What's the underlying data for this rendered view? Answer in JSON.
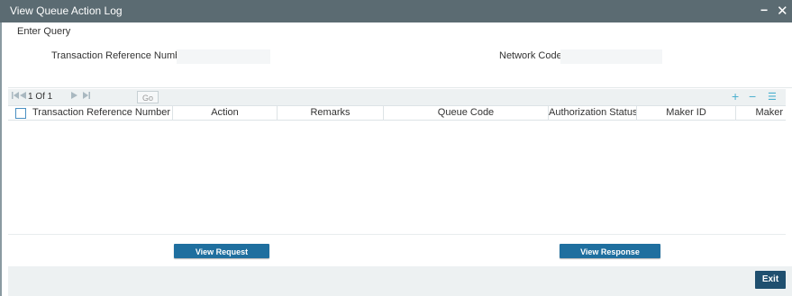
{
  "window": {
    "title": "View Queue Action Log",
    "minimize_icon": "−",
    "close_icon": "✕"
  },
  "query": {
    "section_title": "Enter Query",
    "txn_ref_label": "Transaction Reference Number",
    "txn_ref_value": "",
    "network_code_label": "Network Code",
    "network_code_value": ""
  },
  "pager": {
    "first_icon": "first-page-icon",
    "prev_icon": "prev-page-icon",
    "page_text": "1 Of 1",
    "next_icon": "next-page-icon",
    "last_icon": "last-page-icon",
    "go_label": "Go",
    "add_icon": "+",
    "remove_icon": "−",
    "view_icon": "☰"
  },
  "grid": {
    "columns": [
      "Transaction Reference Number",
      "Action",
      "Remarks",
      "Queue Code",
      "Authorization Status",
      "Maker ID",
      "Maker"
    ],
    "rows": []
  },
  "actions": {
    "view_request": "View Request Message",
    "view_response": "View Response Message"
  },
  "footer": {
    "exit_label": "Exit"
  }
}
